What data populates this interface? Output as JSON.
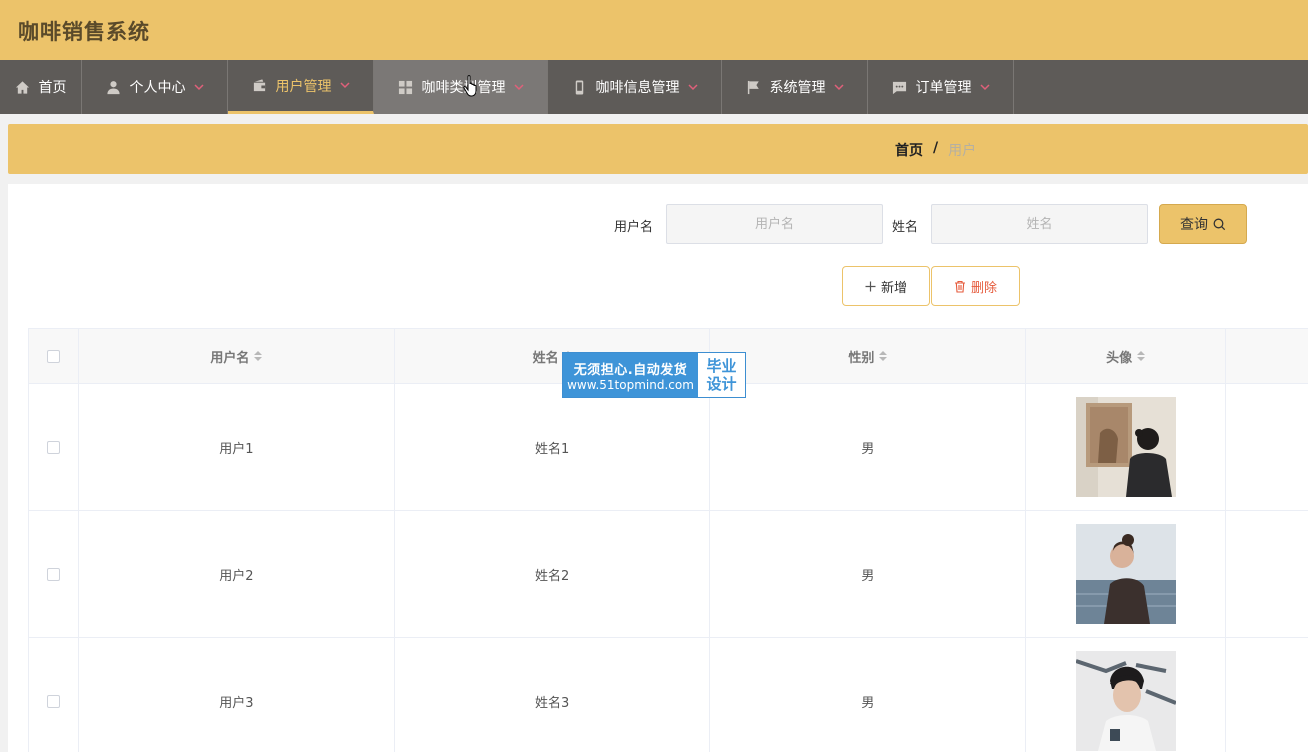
{
  "app": {
    "title": "咖啡销售系统"
  },
  "nav": {
    "items": [
      {
        "label": "首页",
        "icon": "home-icon",
        "dropdown": false
      },
      {
        "label": "个人中心",
        "icon": "user-icon",
        "dropdown": true
      },
      {
        "label": "用户管理",
        "icon": "wallet-icon",
        "dropdown": true,
        "active": true
      },
      {
        "label": "咖啡类型管理",
        "icon": "grid-icon",
        "dropdown": true,
        "hover": true
      },
      {
        "label": "咖啡信息管理",
        "icon": "mobile-icon",
        "dropdown": true
      },
      {
        "label": "系统管理",
        "icon": "flag-icon",
        "dropdown": true
      },
      {
        "label": "订单管理",
        "icon": "message-icon",
        "dropdown": true
      }
    ]
  },
  "breadcrumb": {
    "home": "首页",
    "separator": "/",
    "current": "用户"
  },
  "search": {
    "username_label": "用户名",
    "username_placeholder": "用户名",
    "name_label": "姓名",
    "name_placeholder": "姓名",
    "query_label": "查询"
  },
  "actions": {
    "add_label": "新增",
    "delete_label": "删除"
  },
  "table": {
    "headers": [
      "用户名",
      "姓名",
      "性别",
      "头像"
    ],
    "rows": [
      {
        "username": "用户1",
        "name": "姓名1",
        "gender": "男"
      },
      {
        "username": "用户2",
        "name": "姓名2",
        "gender": "男"
      },
      {
        "username": "用户3",
        "name": "姓名3",
        "gender": "男"
      }
    ]
  },
  "watermark": {
    "line1": "无须担心.自动发货",
    "line2": "www.51topmind.com",
    "badge1": "毕业",
    "badge2": "设计"
  },
  "colors": {
    "accent": "#ecc36a",
    "nav_bg": "#5e5b58",
    "danger": "#e55a3b",
    "watermark": "#3e94d8"
  }
}
